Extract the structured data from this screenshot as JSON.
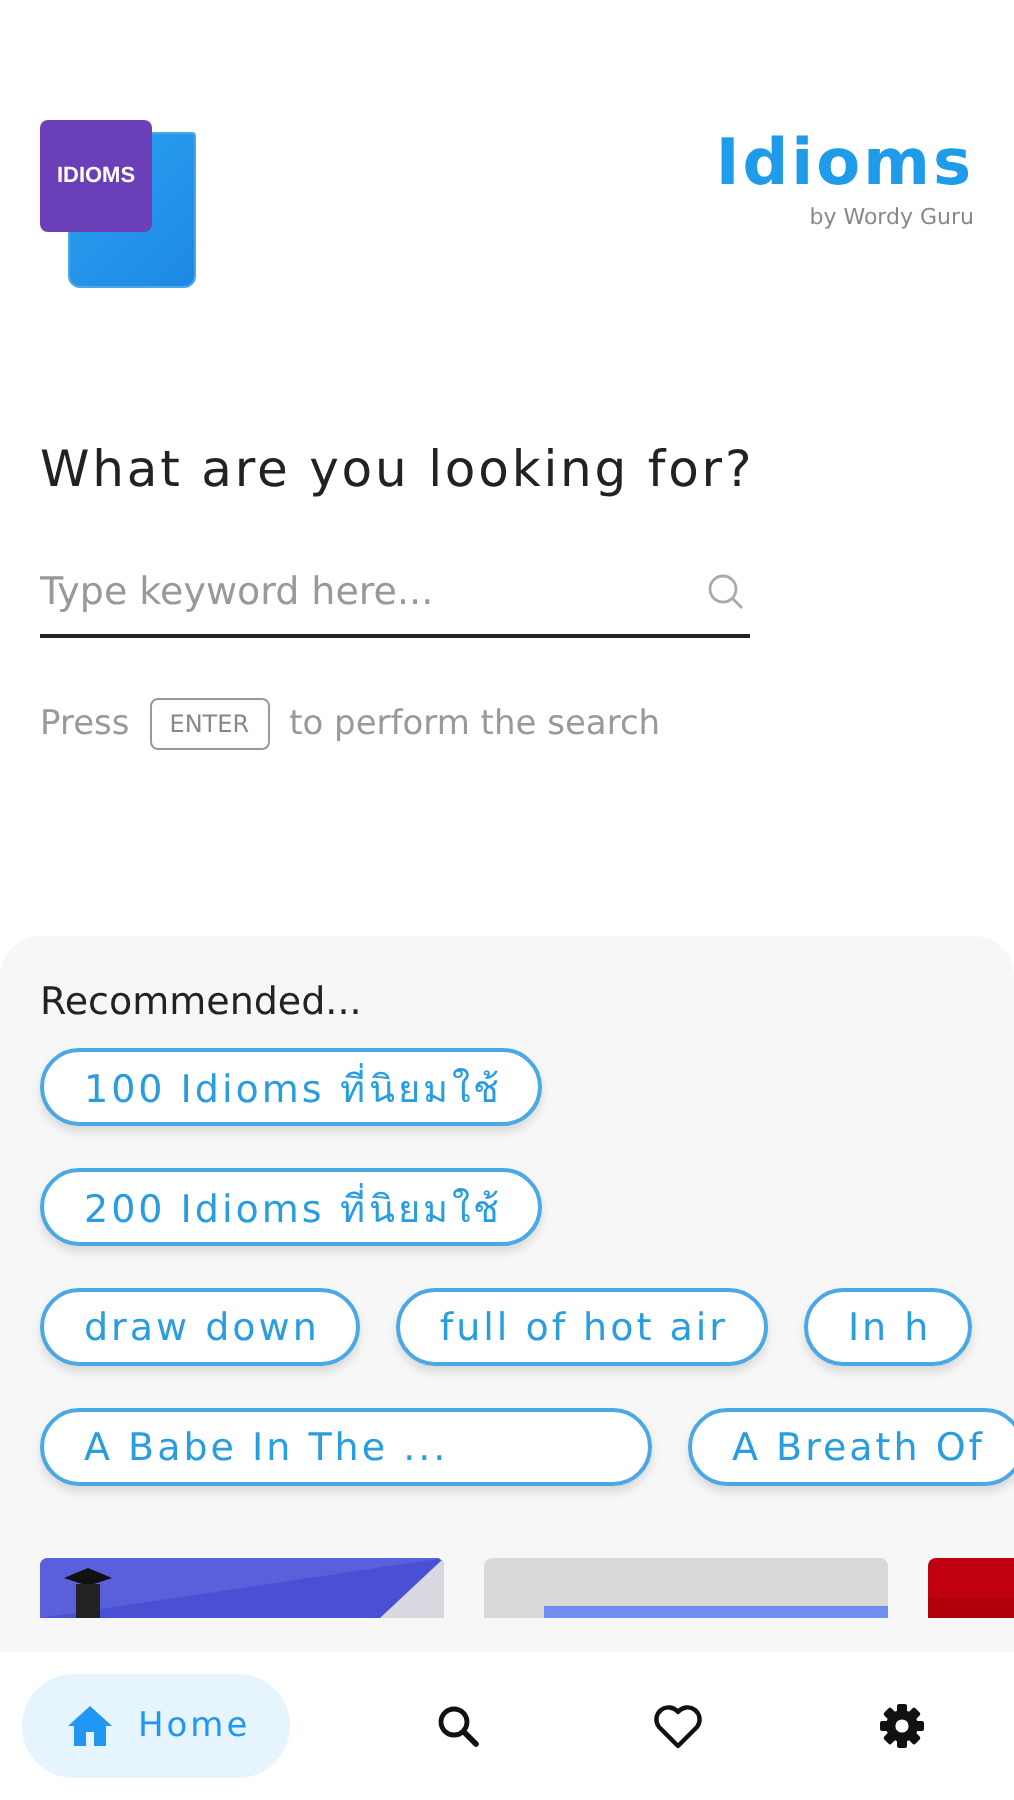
{
  "header": {
    "logo_text": "IDIOMS",
    "title": "Idioms",
    "subtitle": "by Wordy Guru"
  },
  "search": {
    "heading": "What are you looking for?",
    "placeholder": "Type keyword here...",
    "hint_before": "Press",
    "key": "ENTER",
    "hint_after": "to perform the search"
  },
  "recommended": {
    "title": "Recommended...",
    "chips": [
      "100 Idioms ที่นิยมใช้",
      "200 Idioms ที่นิยมใช้",
      "draw down",
      "full of hot air",
      "In h",
      "A Babe In The ...",
      "A Breath Of"
    ]
  },
  "nav": [
    {
      "label": "Home",
      "selected": true
    },
    {
      "selected": false
    },
    {
      "selected": false
    },
    {
      "selected": false
    }
  ]
}
